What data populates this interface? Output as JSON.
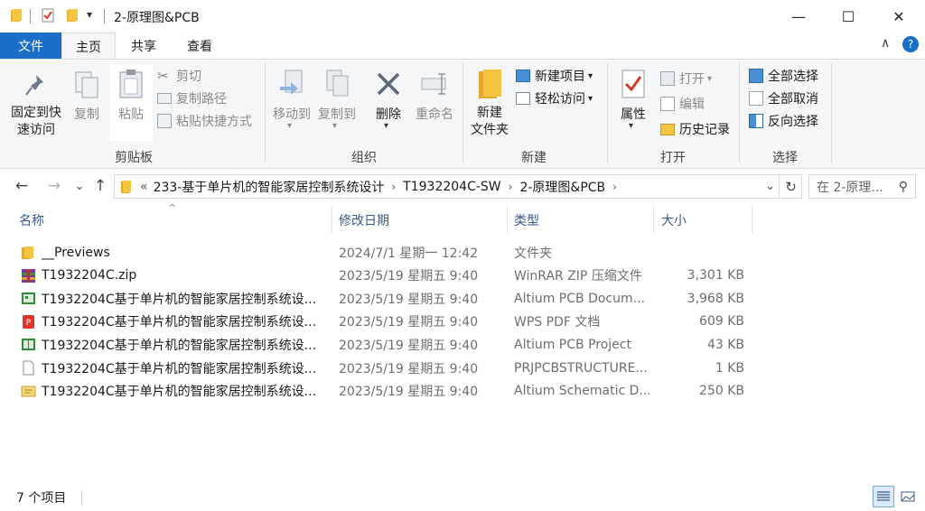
{
  "window": {
    "title": "2-原理图&PCB",
    "minimize": "—",
    "maximize": "☐",
    "close": "✕"
  },
  "tabs": {
    "file": "文件",
    "home": "主页",
    "share": "共享",
    "view": "查看"
  },
  "ribbon": {
    "clipboard": {
      "pin": "固定到快\n速访问",
      "pin_line1": "固定到快",
      "pin_line2": "速访问",
      "copy": "复制",
      "paste": "粘贴",
      "cut": "剪切",
      "copy_path": "复制路径",
      "paste_shortcut": "粘贴快捷方式",
      "label": "剪贴板"
    },
    "organize": {
      "move_to": "移动到",
      "copy_to": "复制到",
      "delete": "删除",
      "rename": "重命名",
      "label": "组织"
    },
    "new": {
      "new_folder_line1": "新建",
      "new_folder_line2": "文件夹",
      "new_item": "新建项目",
      "easy_access": "轻松访问",
      "label": "新建"
    },
    "open": {
      "properties": "属性",
      "open": "打开",
      "edit": "编辑",
      "history": "历史记录",
      "label": "打开"
    },
    "select": {
      "select_all": "全部选择",
      "select_none": "全部取消",
      "invert": "反向选择",
      "label": "选择"
    }
  },
  "nav": {
    "back": "←",
    "forward": "→",
    "recent": "⌄",
    "up": "↑",
    "overflow": "«",
    "breadcrumb": [
      "233-基于单片机的智能家居控制系统设计",
      "T1932204C-SW",
      "2-原理图&PCB"
    ],
    "search_placeholder": "在 2-原理..."
  },
  "columns": {
    "name": "名称",
    "date": "修改日期",
    "type": "类型",
    "size": "大小"
  },
  "files": [
    {
      "icon": "folder-icon",
      "name": "__Previews",
      "date": "2024/7/1 星期一 12:42",
      "type": "文件夹",
      "size": ""
    },
    {
      "icon": "winrar-zip-icon",
      "name": "T1932204C.zip",
      "date": "2023/5/19 星期五 9:40",
      "type": "WinRAR ZIP 压缩文件",
      "size": "3,301 KB"
    },
    {
      "icon": "pcb-document-icon",
      "name": "T1932204C基于单片机的智能家居控制系统设...",
      "date": "2023/5/19 星期五 9:40",
      "type": "Altium PCB Docum...",
      "size": "3,968 KB"
    },
    {
      "icon": "pdf-icon",
      "name": "T1932204C基于单片机的智能家居控制系统设...",
      "date": "2023/5/19 星期五 9:40",
      "type": "WPS PDF 文档",
      "size": "609 KB"
    },
    {
      "icon": "pcb-project-icon",
      "name": "T1932204C基于单片机的智能家居控制系统设...",
      "date": "2023/5/19 星期五 9:40",
      "type": "Altium PCB Project",
      "size": "43 KB"
    },
    {
      "icon": "blank-file-icon",
      "name": "T1932204C基于单片机的智能家居控制系统设...",
      "date": "2023/5/19 星期五 9:40",
      "type": "PRJPCBSTRUCTURE...",
      "size": "1 KB"
    },
    {
      "icon": "schematic-icon",
      "name": "T1932204C基于单片机的智能家居控制系统设...",
      "date": "2023/5/19 星期五 9:40",
      "type": "Altium Schematic D...",
      "size": "250 KB"
    }
  ],
  "status": {
    "item_count": "7 个项目"
  },
  "colors": {
    "accent": "#1a6ec8",
    "folder": "#f5c542",
    "header_text": "#3a5a8c"
  }
}
